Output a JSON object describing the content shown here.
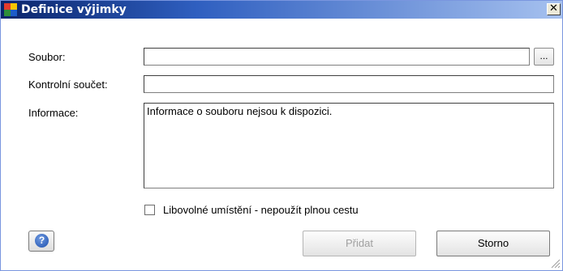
{
  "window": {
    "title": "Definice výjimky",
    "close_glyph": "✕"
  },
  "form": {
    "file_label": "Soubor:",
    "file_value": "",
    "browse_label": "...",
    "checksum_label": "Kontrolní součet:",
    "checksum_value": "",
    "info_label": "Informace:",
    "info_value": "Informace o souboru nejsou k dispozici.",
    "anywhere_label": "Libovolné umístění - nepoužít plnou cestu",
    "anywhere_checked": false
  },
  "buttons": {
    "help_glyph": "?",
    "add_label": "Přidat",
    "cancel_label": "Storno"
  },
  "icons": {
    "app": "avg-app-icon",
    "help": "question-icon",
    "resize": "resize-grip-icon"
  },
  "colors": {
    "title_start": "#0a246a",
    "title_end": "#a6c1ef",
    "help_blue": "#1d4fae"
  }
}
